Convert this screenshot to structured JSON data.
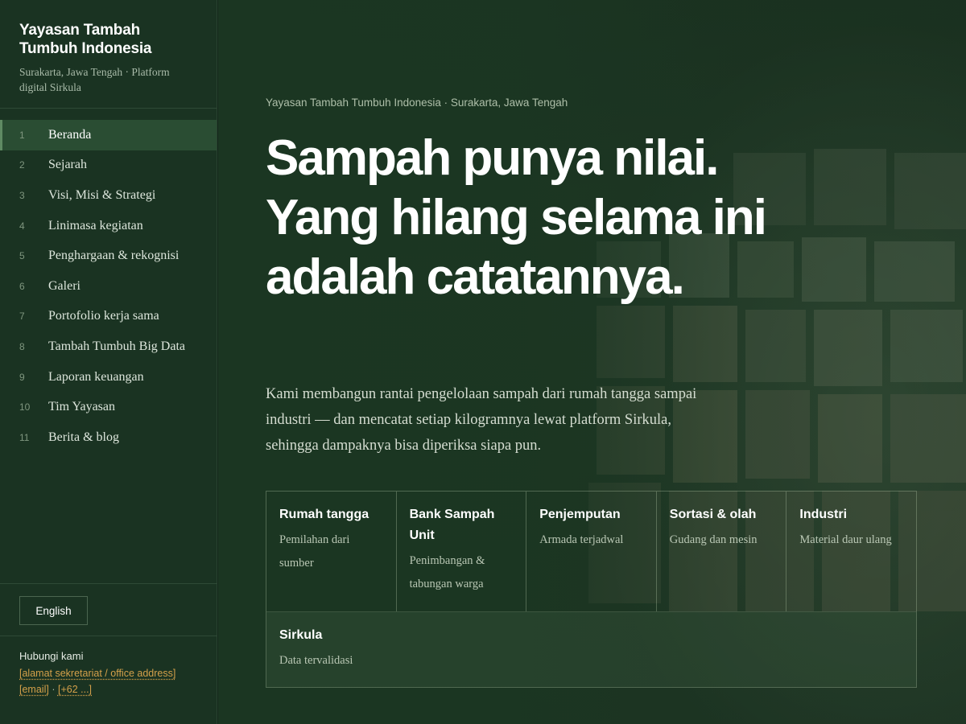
{
  "brand": {
    "name": "Yayasan Tambah Tumbuh Indonesia",
    "subtitle": "Surakarta, Jawa Tengah · Platform digital Sirkula"
  },
  "nav": {
    "items": [
      {
        "num": "1",
        "label": "Beranda",
        "active": true
      },
      {
        "num": "2",
        "label": "Sejarah"
      },
      {
        "num": "3",
        "label": "Visi, Misi & Strategi"
      },
      {
        "num": "4",
        "label": "Linimasa kegiatan"
      },
      {
        "num": "5",
        "label": "Penghargaan & rekognisi"
      },
      {
        "num": "6",
        "label": "Galeri"
      },
      {
        "num": "7",
        "label": "Portofolio kerja sama"
      },
      {
        "num": "8",
        "label": "Tambah Tumbuh Big Data"
      },
      {
        "num": "9",
        "label": "Laporan keuangan"
      },
      {
        "num": "10",
        "label": "Tim Yayasan"
      },
      {
        "num": "11",
        "label": "Berita & blog"
      }
    ]
  },
  "language": {
    "label": "English"
  },
  "contact": {
    "title": "Hubungi kami",
    "address": "[alamat sekretariat / office address]",
    "email": "[email]",
    "separator": "·",
    "phone": "[+62 ...]"
  },
  "hero": {
    "eyebrow": "Yayasan Tambah Tumbuh Indonesia · Surakarta, Jawa Tengah",
    "headline": "Sampah punya nilai. Yang hilang selama ini adalah catatannya.",
    "lede": "Kami membangun rantai pengelolaan sampah dari rumah tangga sampai industri — dan mencatat setiap kilogramnya lewat platform Sirkula, sehingga dampaknya bisa diperiksa siapa pun.",
    "flow": [
      {
        "title": "Rumah tangga",
        "sub": "Pemilahan dari sumber"
      },
      {
        "title": "Bank Sampah Unit",
        "sub": "Penimbangan & tabungan warga"
      },
      {
        "title": "Penjemputan",
        "sub": "Armada terjadwal"
      },
      {
        "title": "Sortasi & olah",
        "sub": "Gudang dan mesin"
      },
      {
        "title": "Industri",
        "sub": "Material daur ulang"
      }
    ],
    "final": {
      "title": "Sirkula",
      "sub": "Data tervalidasi"
    }
  },
  "colors": {
    "sidebar_bg": "#1a3322",
    "active_bg": "#2a4d33",
    "accent_link": "#d4a04a"
  }
}
